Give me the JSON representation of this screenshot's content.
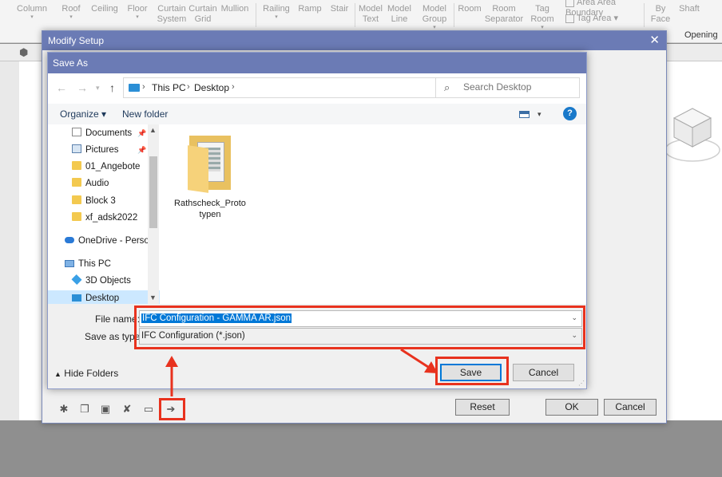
{
  "ribbon": {
    "items": [
      {
        "label": "Column",
        "caret": true
      },
      {
        "label": "Roof",
        "caret": true
      },
      {
        "label": "Ceiling",
        "caret": false
      },
      {
        "label": "Floor",
        "caret": true
      },
      {
        "label": "Curtain System",
        "caret": false
      },
      {
        "label": "Curtain Grid",
        "caret": false
      },
      {
        "label": "Mullion",
        "caret": false
      },
      {
        "label": "Railing",
        "caret": true
      },
      {
        "label": "Ramp",
        "caret": false
      },
      {
        "label": "Stair",
        "caret": false
      },
      {
        "label": "Model Text",
        "caret": false
      },
      {
        "label": "Model Line",
        "caret": false
      },
      {
        "label": "Model Group",
        "caret": true
      },
      {
        "label": "Room",
        "caret": false
      },
      {
        "label": "Room Separator",
        "caret": false
      },
      {
        "label": "Tag Room",
        "caret": true
      },
      {
        "label": "Area",
        "caret": false
      },
      {
        "label": "Area Boundary",
        "caret": false
      },
      {
        "label": "Tag Area",
        "caret": true
      },
      {
        "label": "By Face",
        "caret": false
      },
      {
        "label": "Shaft",
        "caret": false
      }
    ],
    "panel_opening": "Opening"
  },
  "modify_setup": {
    "title": "Modify Setup",
    "close_glyph": "✕",
    "buttons": {
      "reset": "Reset",
      "ok": "OK",
      "cancel": "Cancel"
    },
    "tool_icons": [
      "new-setup-icon",
      "duplicate-setup-icon",
      "rename-setup-icon",
      "delete-setup-icon",
      "load-setup-icon",
      "save-setup-icon"
    ]
  },
  "save_as": {
    "title": "Save As",
    "breadcrumb": [
      "This PC",
      "Desktop"
    ],
    "search_placeholder": "Search Desktop",
    "organize": "Organize ▾",
    "new_folder": "New folder",
    "help": "?",
    "tree": [
      {
        "label": "Documents",
        "icon": "doc",
        "pinned": true
      },
      {
        "label": "Pictures",
        "icon": "pic",
        "pinned": true
      },
      {
        "label": "01_Angebote",
        "icon": "folder",
        "pinned": false
      },
      {
        "label": "Audio",
        "icon": "folder",
        "pinned": false
      },
      {
        "label": "Block 3",
        "icon": "folder",
        "pinned": false
      },
      {
        "label": "xf_adsk2022",
        "icon": "folder",
        "pinned": false
      },
      {
        "label": "OneDrive - Person",
        "icon": "cloud",
        "pinned": false
      },
      {
        "label": "This PC",
        "icon": "pc",
        "pinned": false
      },
      {
        "label": "3D Objects",
        "icon": "3d",
        "pinned": false
      },
      {
        "label": "Desktop",
        "icon": "desk",
        "pinned": false
      }
    ],
    "files": [
      {
        "name": "Rathscheck_Prototypen",
        "line1": "Rathscheck_Proto",
        "line2": "typen"
      }
    ],
    "file_name_label": "File name:",
    "file_name_value": "IFC Configuration - GAMMA AR.json",
    "save_type_label": "Save as type:",
    "save_type_value": "IFC Configuration (*.json)",
    "hide_folders": "Hide Folders",
    "save_button": "Save",
    "cancel_button": "Cancel"
  },
  "annotation_color": "#e8321e"
}
